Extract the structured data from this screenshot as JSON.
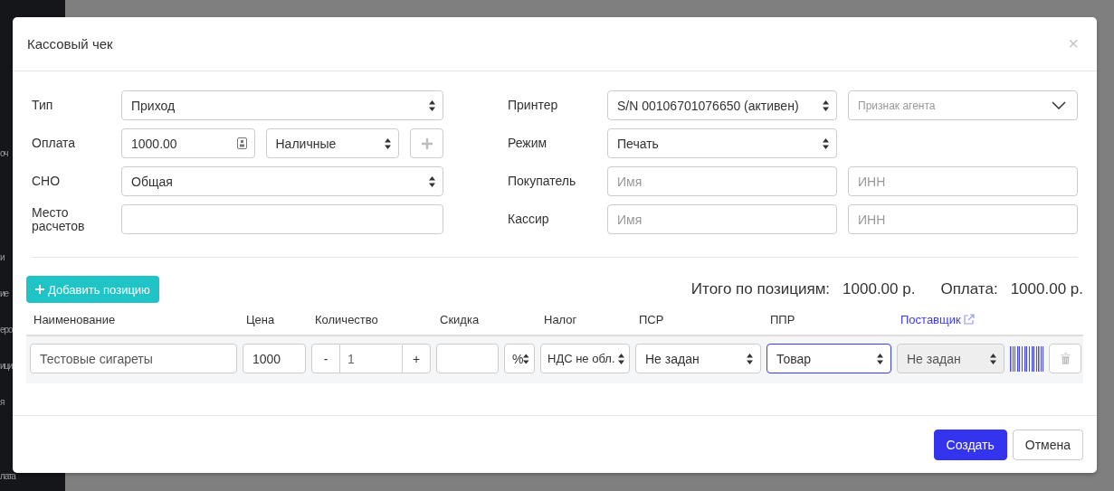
{
  "background": {
    "sidebar_fragments": [
      "оч",
      "и",
      "ие",
      "еро",
      "ици",
      "я",
      "лата"
    ]
  },
  "dialog": {
    "title": "Кассовый чек",
    "close": "×"
  },
  "form_left": [
    {
      "label": "Тип",
      "fields": [
        {
          "kind": "select",
          "value": "Приход"
        }
      ]
    },
    {
      "label": "Оплата",
      "fields": [
        {
          "kind": "number",
          "value": "1000.00"
        },
        {
          "kind": "select",
          "value": "Наличные"
        },
        {
          "kind": "add"
        }
      ]
    },
    {
      "label": "СНО",
      "fields": [
        {
          "kind": "select",
          "value": "Общая"
        }
      ]
    },
    {
      "label": "Место расчетов",
      "fields": [
        {
          "kind": "input"
        }
      ]
    }
  ],
  "form_right": [
    {
      "label": "Принтер",
      "fields": [
        {
          "kind": "select",
          "value": "S/N 00106701076650 (активен)"
        },
        {
          "kind": "dropdown",
          "placeholder": "Признак агента"
        }
      ]
    },
    {
      "label": "Режим",
      "fields": [
        {
          "kind": "select",
          "value": "Печать"
        }
      ]
    },
    {
      "label": "Покупатель",
      "fields": [
        {
          "kind": "input",
          "placeholder": "Имя"
        },
        {
          "kind": "input",
          "placeholder": "ИНН"
        }
      ]
    },
    {
      "label": "Кассир",
      "fields": [
        {
          "kind": "input",
          "placeholder": "Имя"
        },
        {
          "kind": "input",
          "placeholder": "ИНН"
        }
      ]
    }
  ],
  "add_item_button": "Добавить позицию",
  "totals": [
    {
      "label": "Итого по позициям:",
      "value": "1000.00 р."
    },
    {
      "label": "Оплата:",
      "value": "1000.00 р."
    }
  ],
  "columns": [
    {
      "label": "Наименование",
      "kind": "text"
    },
    {
      "label": "Цена",
      "kind": "text"
    },
    {
      "label": "Количество",
      "kind": "text"
    },
    {
      "label": "Скидка",
      "kind": "text"
    },
    {
      "label": "Налог",
      "kind": "text"
    },
    {
      "label": "ПСР",
      "kind": "text"
    },
    {
      "label": "ППР",
      "kind": "text"
    },
    {
      "label": "Поставщик",
      "kind": "link"
    }
  ],
  "items": [
    {
      "name": "Тестовые сигареты",
      "price": "1000",
      "minus": "-",
      "quantity": "1",
      "plus": "+",
      "discount_unit": "%",
      "tax": "НДС не обл.",
      "psr": "Не задан",
      "ppr": "Товар",
      "ppr_focused": true,
      "supplier": "Не задан",
      "supplier_disabled": true
    }
  ],
  "footer_buttons": [
    {
      "label": "Создать",
      "kind": "primary"
    },
    {
      "label": "Отмена",
      "kind": "default"
    }
  ]
}
